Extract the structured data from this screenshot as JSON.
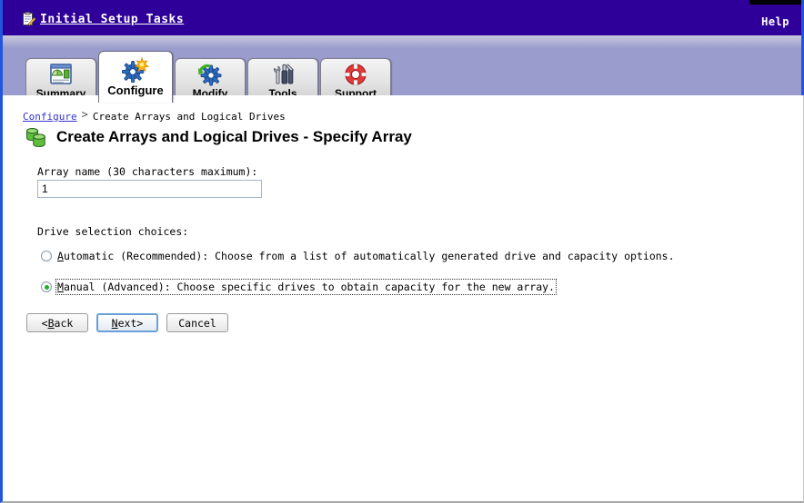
{
  "banner": {
    "task_link_label": "Initial Setup Tasks",
    "task_link_icon": "clipboard-pencil-icon",
    "help_label": "Help",
    "background_color": "#2e0099",
    "text_color": "#ffffff"
  },
  "tabs": {
    "background_color": "#9a9ccd",
    "items": [
      {
        "label": "Summary",
        "icon": "report-chart-icon",
        "active": false
      },
      {
        "label": "Configure",
        "icon": "gear-star-icon",
        "active": true
      },
      {
        "label": "Modify",
        "icon": "gear-refresh-icon",
        "active": false
      },
      {
        "label": "Tools",
        "icon": "hammer-wrench-icon",
        "active": false
      },
      {
        "label": "Support",
        "icon": "life-preserver-icon",
        "active": false
      }
    ]
  },
  "breadcrumb": {
    "link": "Configure",
    "separator": ">",
    "current": "Create Arrays and Logical Drives",
    "link_color": "#3333cc"
  },
  "page": {
    "title": "Create Arrays and Logical Drives - Specify Array",
    "title_icon": "green-drives-icon"
  },
  "form": {
    "array_name_label": "Array name (30 characters maximum):",
    "array_name_value": "1",
    "array_name_placeholder": "",
    "choices_label": "Drive selection choices:",
    "options": [
      {
        "id": "automatic",
        "accesskey": "A",
        "label_rest": "utomatic (Recommended): Choose from a list of automatically generated drive and capacity options.",
        "checked": false,
        "focused": false
      },
      {
        "id": "manual",
        "accesskey": "M",
        "label_rest": "anual (Advanced): Choose specific drives to obtain capacity for the new array.",
        "checked": true,
        "focused": true
      }
    ]
  },
  "buttons": {
    "back": {
      "prefix": "< ",
      "accesskey": "B",
      "rest": "ack",
      "suffix": "",
      "default": false
    },
    "next": {
      "prefix": "",
      "accesskey": "N",
      "rest": "ext",
      "suffix": " >",
      "default": true
    },
    "cancel": {
      "prefix": "",
      "accesskey": "",
      "rest": "Cancel",
      "suffix": "",
      "default": false
    }
  }
}
